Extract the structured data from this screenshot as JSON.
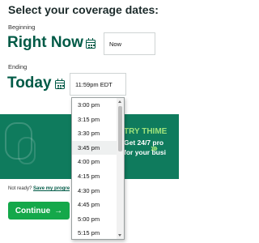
{
  "heading": "Select your coverage dates:",
  "beginning": {
    "label": "Beginning",
    "value": "Right Now",
    "input_value": "Now"
  },
  "ending": {
    "label": "Ending",
    "value": "Today",
    "time_value": "11:59pm EDT"
  },
  "banner": {
    "try_text": "TRY THIME",
    "line1": "Get 24/7 pro",
    "line2": "for your busi",
    "chevrons": "›››"
  },
  "footer": {
    "not_ready": "Not ready?",
    "save_link": "Save my progre"
  },
  "continue": {
    "label": "Continue",
    "arrow": "→"
  },
  "time_options": [
    "3:00 pm",
    "3:15 pm",
    "3:30 pm",
    "3:45 pm",
    "4:00 pm",
    "4:15 pm",
    "4:30 pm",
    "4:45 pm",
    "5:00 pm",
    "5:15 pm"
  ],
  "highlighted_option": "3:45 pm",
  "colors": {
    "brand_green": "#005a46",
    "banner_green": "#0f7b5d",
    "accent_lime": "#9fe27b",
    "button_green": "#14a84a"
  }
}
